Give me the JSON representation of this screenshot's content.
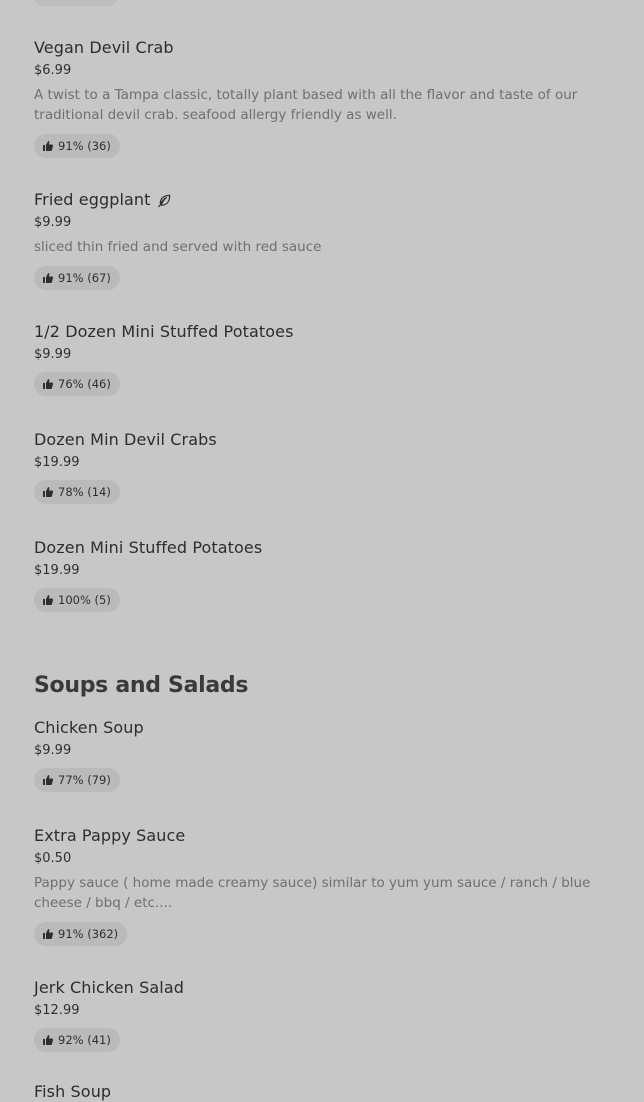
{
  "sections": [
    {
      "items": [
        {
          "name": "Vegan Devil Crab",
          "price": "$6.99",
          "description": "A twist to a Tampa classic, totally plant based with all the flavor and taste of our traditional devil crab. seafood allergy friendly as well.",
          "rating": "91% (36)"
        },
        {
          "name": "Fried eggplant",
          "vegetarian_icon": "leaf-icon",
          "price": "$9.99",
          "description": "sliced thin fried and served with red sauce",
          "rating": "91% (67)"
        },
        {
          "name": "1/2 Dozen Mini Stuffed Potatoes",
          "price": "$9.99",
          "rating": "76% (46)"
        },
        {
          "name": "Dozen Min Devil Crabs",
          "price": "$19.99",
          "rating": "78% (14)"
        },
        {
          "name": "Dozen Mini Stuffed Potatoes",
          "price": "$19.99",
          "rating": "100% (5)"
        }
      ]
    },
    {
      "title": "Soups and Salads",
      "items": [
        {
          "name": "Chicken Soup",
          "price": "$9.99",
          "rating": "77% (79)"
        },
        {
          "name": "Extra Pappy Sauce",
          "price": "$0.50",
          "description": "Pappy sauce ( home made creamy sauce) similar to yum yum sauce / ranch / blue cheese / bbq / etc....",
          "rating": "91% (362)"
        },
        {
          "name": "Jerk Chicken Salad",
          "price": "$12.99",
          "rating": "92% (41)"
        },
        {
          "name": "Fish Soup"
        }
      ]
    }
  ],
  "icons": {
    "rating": "thumbs-up-icon",
    "vegetarian": "leaf-icon"
  }
}
